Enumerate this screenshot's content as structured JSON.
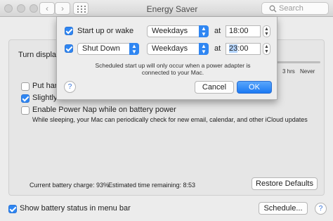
{
  "window": {
    "title": "Energy Saver",
    "search_placeholder": "Search",
    "back_glyph": "‹",
    "forward_glyph": "›"
  },
  "pane": {
    "turn_display_label": "Turn display",
    "slider_labels": [
      "3 hrs",
      "Never"
    ],
    "put_hard_label": "Put hard",
    "slightly_label": "Slightly",
    "power_nap_label": "Enable Power Nap while on battery power",
    "power_nap_desc": "While sleeping, your Mac can periodically check for new email, calendar, and other iCloud updates",
    "battery_charge": "Current battery charge: 93%",
    "time_remaining": "Estimated time remaining: 8:53",
    "restore_defaults": "Restore Defaults",
    "show_battery_label": "Show battery status in menu bar",
    "schedule_button": "Schedule...",
    "checkboxes": {
      "put_hard": false,
      "slightly": true,
      "power_nap": false,
      "show_battery": true
    }
  },
  "dialog": {
    "row1": {
      "checked": true,
      "label": "Start up or wake",
      "days": "Weekdays",
      "at": "at",
      "time": "18:00"
    },
    "row2": {
      "checked": true,
      "action": "Shut Down",
      "days": "Weekdays",
      "at": "at",
      "time_hours": "23",
      "time_minutes": ":00"
    },
    "note": "Scheduled start up will only occur when a power adapter is connected to your Mac.",
    "help": "?",
    "cancel": "Cancel",
    "ok": "OK"
  },
  "colors": {
    "accent": "#2f86f2",
    "window_bg": "#ececec"
  }
}
